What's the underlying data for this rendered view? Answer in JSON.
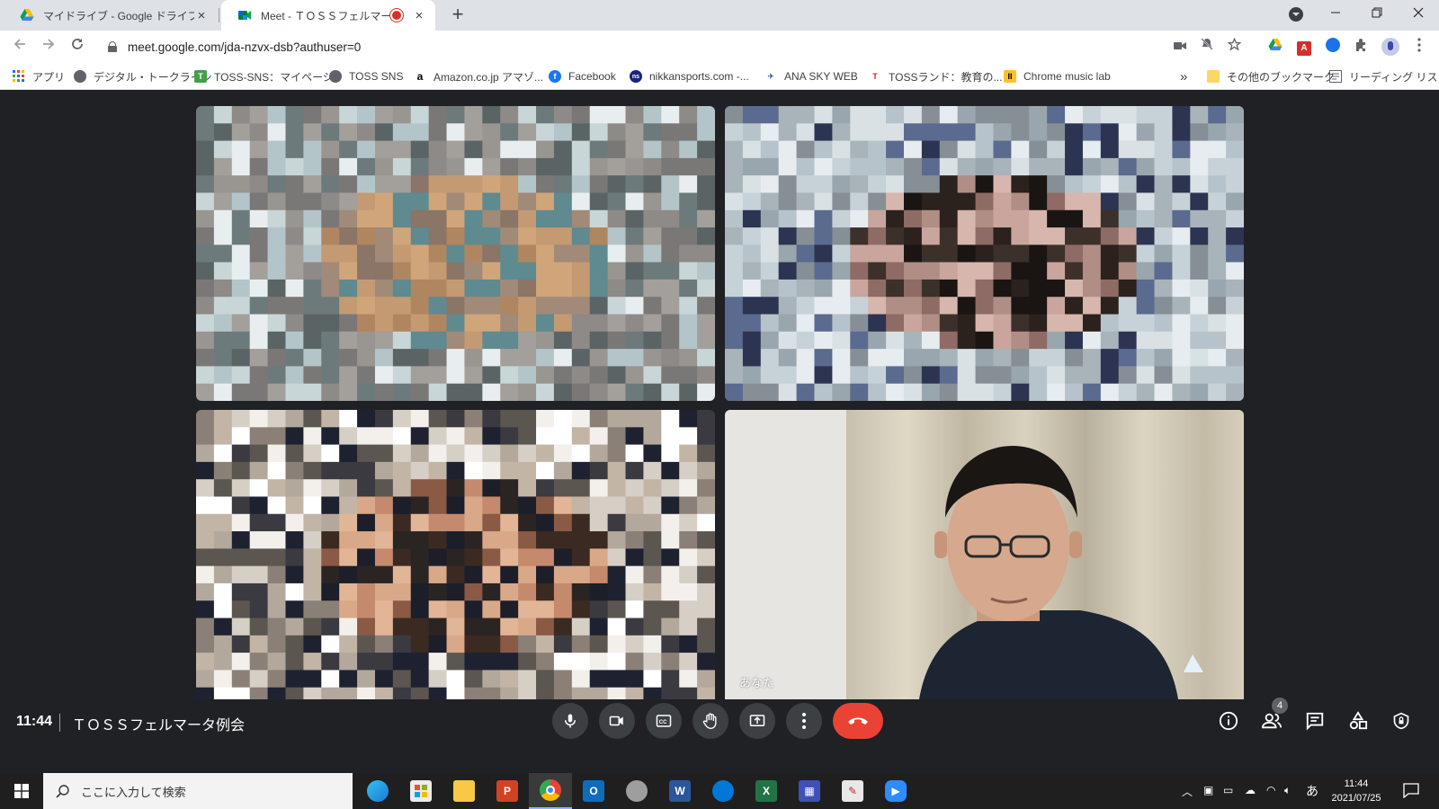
{
  "browser": {
    "tabs": [
      {
        "label": "マイドライブ - Google ドライブ",
        "active": false
      },
      {
        "label": "Meet - ＴＯＳＳフェルマータ例",
        "active": true
      }
    ],
    "url": "meet.google.com/jda-nzvx-dsb?authuser=0",
    "new_tab_glyph": "+",
    "close_glyph": "×"
  },
  "bookmarks": [
    {
      "label": "アプリ",
      "icon": "apps-grid-icon"
    },
    {
      "label": "デジタル・トークライン",
      "icon": "globe-icon"
    },
    {
      "label": "TOSS-SNS：マイページ",
      "icon": "toss-sns-icon"
    },
    {
      "label": "TOSS SNS",
      "icon": "globe-icon"
    },
    {
      "label": "Amazon.co.jp アマゾ...",
      "icon": "amazon-icon"
    },
    {
      "label": "Facebook",
      "icon": "facebook-icon"
    },
    {
      "label": "nikkansports.com -...",
      "icon": "nikkansports-icon"
    },
    {
      "label": "ANA SKY WEB",
      "icon": "ana-icon"
    },
    {
      "label": "TOSSランド：教育の...",
      "icon": "tossland-icon"
    },
    {
      "label": "Chrome music lab",
      "icon": "chrome-music-lab-icon"
    }
  ],
  "bookmarks_overflow": "»",
  "other_bookmarks": "その他のブックマーク",
  "reading_list": "リーディング リスト",
  "meet": {
    "self_label": "あなた",
    "time": "11:44",
    "meeting_title": "ＴＯＳＳフェルマータ例会",
    "participants_count": "4"
  },
  "taskbar": {
    "search_placeholder": "ここに入力して検索",
    "time": "11:44",
    "date": "2021/07/25",
    "ime": "あ"
  },
  "colors": {
    "meet_bg": "#202124",
    "end_call": "#ea4335",
    "active_speaker_border": "#8ab4f8"
  }
}
